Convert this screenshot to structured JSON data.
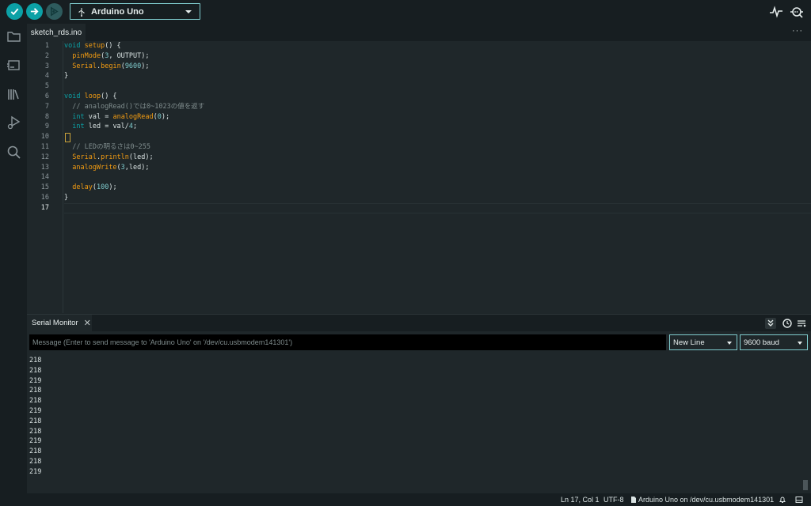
{
  "toolbar": {
    "board": "Arduino Uno",
    "icons": [
      "verify-icon",
      "upload-icon",
      "debug-icon",
      "usb-icon",
      "serial-plotter-icon",
      "serial-monitor-icon"
    ]
  },
  "sidebar": {
    "icons": [
      "sketchbook-folder-icon",
      "boards-manager-icon",
      "library-manager-icon",
      "debug-run-icon",
      "search-icon"
    ]
  },
  "tabs": {
    "active": "sketch_rds.ino",
    "more": "···"
  },
  "editor": {
    "line_numbers": [
      "1",
      "2",
      "3",
      "4",
      "5",
      "6",
      "7",
      "8",
      "9",
      "10",
      "11",
      "12",
      "13",
      "14",
      "15",
      "16",
      "17"
    ],
    "active_line": "17",
    "lines": [
      [
        {
          "t": "void ",
          "c": "kw"
        },
        {
          "t": "setup",
          "c": "fn"
        },
        {
          "t": "() {",
          "c": ""
        }
      ],
      [
        {
          "t": "  ",
          "c": ""
        },
        {
          "t": "pinMode",
          "c": "fn"
        },
        {
          "t": "(",
          "c": ""
        },
        {
          "t": "3",
          "c": "num"
        },
        {
          "t": ", OUTPUT);",
          "c": ""
        }
      ],
      [
        {
          "t": "  ",
          "c": ""
        },
        {
          "t": "Serial",
          "c": "fn"
        },
        {
          "t": ".",
          "c": ""
        },
        {
          "t": "begin",
          "c": "fn"
        },
        {
          "t": "(",
          "c": ""
        },
        {
          "t": "9600",
          "c": "num"
        },
        {
          "t": ");",
          "c": ""
        }
      ],
      [
        {
          "t": "}",
          "c": ""
        }
      ],
      [],
      [
        {
          "t": "void ",
          "c": "kw"
        },
        {
          "t": "loop",
          "c": "fn"
        },
        {
          "t": "() {",
          "c": ""
        }
      ],
      [
        {
          "t": "  // analogRead()では0~1023の値を返す",
          "c": "cm"
        }
      ],
      [
        {
          "t": "  ",
          "c": ""
        },
        {
          "t": "int ",
          "c": "kw"
        },
        {
          "t": "val = ",
          "c": ""
        },
        {
          "t": "analogRead",
          "c": "fn"
        },
        {
          "t": "(",
          "c": ""
        },
        {
          "t": "0",
          "c": "num"
        },
        {
          "t": ");",
          "c": ""
        }
      ],
      [
        {
          "t": "  ",
          "c": ""
        },
        {
          "t": "int ",
          "c": "kw"
        },
        {
          "t": "led = val/",
          "c": ""
        },
        {
          "t": "4",
          "c": "num"
        },
        {
          "t": ";",
          "c": ""
        }
      ],
      [],
      [
        {
          "t": "  // LEDの明るさは0~255",
          "c": "cm"
        }
      ],
      [
        {
          "t": "  ",
          "c": ""
        },
        {
          "t": "Serial",
          "c": "fn"
        },
        {
          "t": ".",
          "c": ""
        },
        {
          "t": "println",
          "c": "fn"
        },
        {
          "t": "(led);",
          "c": ""
        }
      ],
      [
        {
          "t": "  ",
          "c": ""
        },
        {
          "t": "analogWrite",
          "c": "fn"
        },
        {
          "t": "(",
          "c": ""
        },
        {
          "t": "3",
          "c": "num"
        },
        {
          "t": ",led);",
          "c": ""
        }
      ],
      [],
      [
        {
          "t": "  ",
          "c": ""
        },
        {
          "t": "delay",
          "c": "fn"
        },
        {
          "t": "(",
          "c": ""
        },
        {
          "t": "100",
          "c": "num"
        },
        {
          "t": ");",
          "c": ""
        }
      ],
      [
        {
          "t": "}",
          "c": ""
        }
      ],
      []
    ]
  },
  "monitor": {
    "tab_label": "Serial Monitor",
    "close": "✕",
    "input_placeholder": "Message (Enter to send message to 'Arduino Uno' on '/dev/cu.usbmodem141301')",
    "line_ending": "New Line",
    "baud": "9600 baud",
    "output": [
      "218",
      "218",
      "219",
      "218",
      "218",
      "219",
      "218",
      "218",
      "219",
      "218",
      "218",
      "219"
    ],
    "icons": [
      "autoscroll-icon",
      "timestamp-icon",
      "clear-output-icon"
    ]
  },
  "status": {
    "position": "Ln 17, Col 1",
    "encoding": "UTF-8",
    "board_port": "Arduino Uno on /dev/cu.usbmodem141301",
    "icons": [
      "board-file-icon",
      "notifications-bell-icon",
      "toggle-output-panel-icon"
    ]
  }
}
